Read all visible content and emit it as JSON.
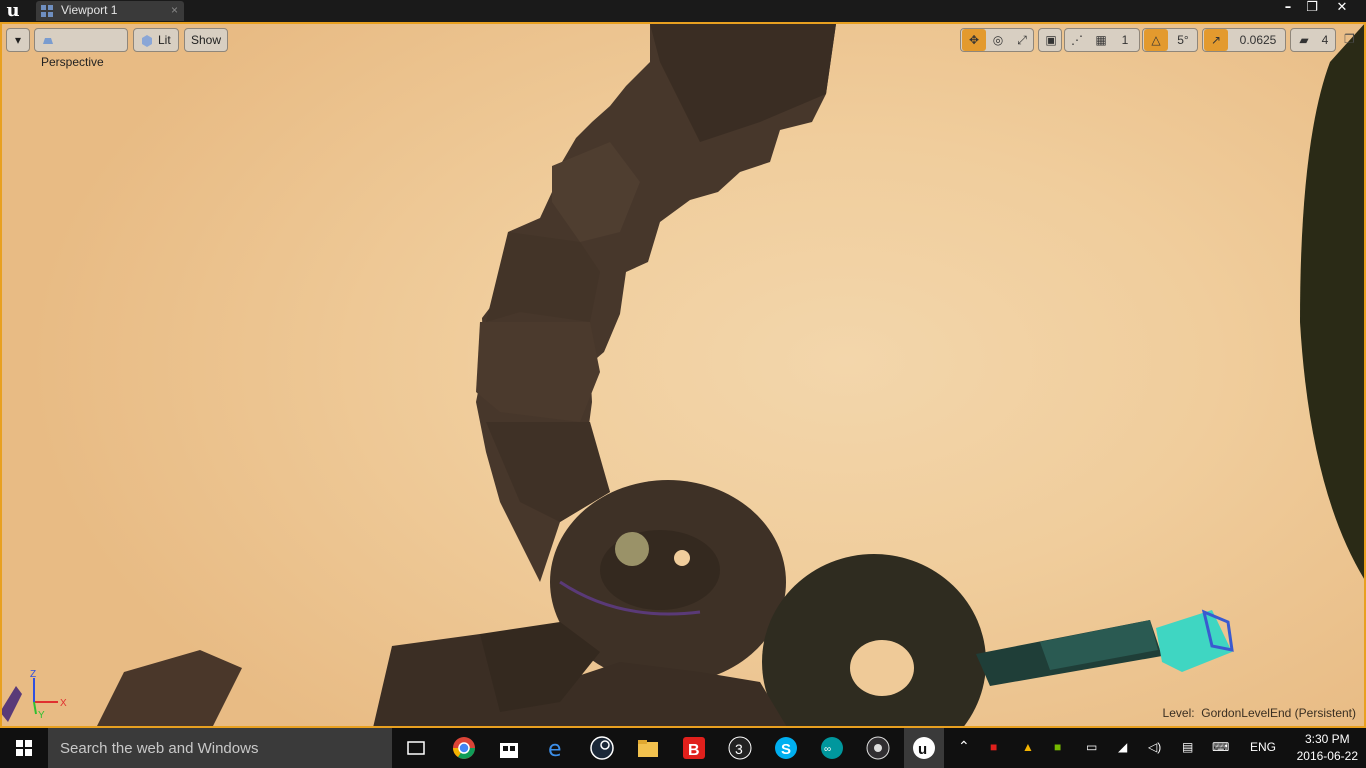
{
  "window": {
    "tab_label": "Viewport 1",
    "tab_close": "×",
    "minimize": "–",
    "restore": "❐",
    "close": "✕"
  },
  "viewport": {
    "menu_arrow": "▾",
    "perspective_label": "Perspective",
    "lit_label": "Lit",
    "show_label": "Show",
    "translate_snap_value": "1",
    "rotate_snap_value": "5°",
    "scale_snap_value": "0.0625",
    "camera_speed_value": "4",
    "level_prefix": "Level:",
    "level_name": "GordonLevelEnd (Persistent)",
    "axis_x": "X",
    "axis_y": "Y",
    "axis_z": "Z",
    "accent_color": "#e8a020"
  },
  "taskbar": {
    "search_placeholder": "Search the web and Windows",
    "language": "ENG",
    "time": "3:30 PM",
    "date": "2016-06-22",
    "pinned": [
      "task-view",
      "chrome",
      "store",
      "edge",
      "steam",
      "file-explorer",
      "bitdefender",
      "unity",
      "skype",
      "arduino",
      "obs",
      "unreal-engine"
    ]
  }
}
